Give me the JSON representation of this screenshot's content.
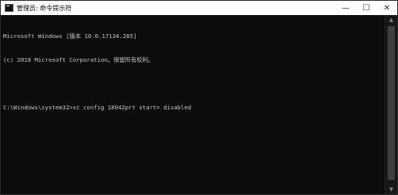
{
  "window": {
    "title": "管理员: 命令提示符",
    "controls": {
      "minimize": "—",
      "maximize": "☐",
      "close": "✕"
    },
    "console_lines": [
      "Microsoft Windows [版本 10.0.17134.285]",
      "(c) 2018 Microsoft Corporation。保留所有权利。",
      "",
      "C:\\Windows\\system32>sc config 18042prt start= disabled"
    ]
  },
  "scrollbar": {
    "up_arrow": "▲",
    "down_arrow": "▼"
  },
  "colors": {
    "console_bg": "#0c0c0c",
    "console_text": "#c8c8c8",
    "titlebar_bg": "#ffffff"
  },
  "icons": {
    "app": "cmd-icon",
    "minimize": "minimize-icon",
    "maximize": "maximize-icon",
    "close": "close-icon"
  }
}
